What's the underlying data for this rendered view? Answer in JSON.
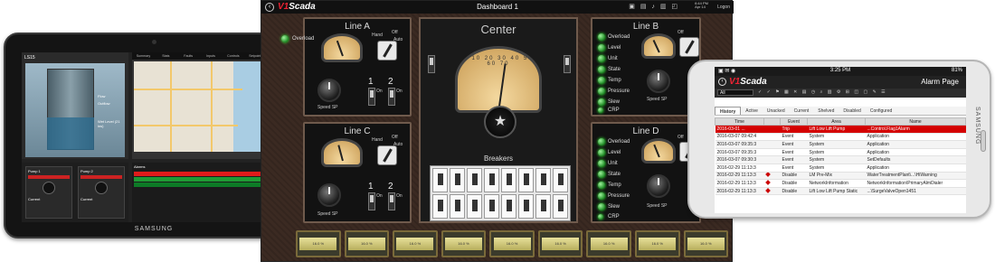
{
  "tablet": {
    "brand": "SAMSUNG",
    "screen_title": "LS15",
    "tabs": [
      "Summary",
      "Stats",
      "Faults",
      "Inputs",
      "Controls",
      "Setpoints",
      "Map"
    ],
    "active_tab": "Map",
    "well_labels": [
      "Flow",
      "Outflow",
      "Wet Level (21 ins)"
    ],
    "pumps": [
      {
        "label": "Pump 1",
        "current": "Current"
      },
      {
        "label": "Pump 2",
        "current": "Current"
      }
    ],
    "alarms_title": "Alarms",
    "alarm_colors": [
      "#e01b1b",
      "#1f9b35",
      "#0d7a26"
    ]
  },
  "dashboard": {
    "logo_a": "V1",
    "logo_b": "Scada",
    "title": "Dashboard 1",
    "time_line1": "6:44 PM",
    "time_line2": "Apr 14",
    "logon": "Logon",
    "lines": [
      {
        "name": "Line A",
        "lamps": [
          "Overload"
        ],
        "hand": "Hand",
        "off": "Off",
        "auto": "Auto",
        "speed": "Speed SP",
        "sw1": "1",
        "sw2": "2",
        "on": "On"
      },
      {
        "name": "Line B",
        "lamps": [
          "Overload",
          "Level",
          "Unit",
          "State",
          "Temp",
          "Pressure",
          "Slew",
          "CRP"
        ],
        "hand": "Hand",
        "off": "Off",
        "auto": "Auto",
        "speed": "Speed SP"
      },
      {
        "name": "Line C",
        "lamps": [],
        "hand": "Hand",
        "off": "Off",
        "auto": "Auto",
        "speed": "Speed SP",
        "sw1": "1",
        "sw2": "2",
        "on": "On"
      },
      {
        "name": "Line D",
        "lamps": [
          "Overload",
          "Level",
          "Unit",
          "State",
          "Temp",
          "Pressure",
          "Slew",
          "CRP"
        ],
        "hand": "Hand",
        "off": "Off",
        "auto": "Auto",
        "speed": "Speed SP"
      }
    ],
    "center_title": "Center",
    "vu_scale": [
      "0",
      "10",
      "20",
      "30",
      "40",
      "50",
      "60",
      "70"
    ],
    "breakers_label": "Breakers",
    "meters": [
      "16.0 %",
      "16.0 %",
      "16.0 %",
      "16.0 %",
      "16.0 %",
      "16.0 %",
      "16.0 %",
      "16.0 %",
      "16.0 %"
    ]
  },
  "phone": {
    "brand": "SAMSUNG",
    "time": "3:25 PM",
    "battery": "81%",
    "logo_a": "V1",
    "logo_b": "Scada",
    "page_title": "Alarm Page",
    "filter": "All",
    "tabs": [
      "History",
      "Active",
      "Unacked",
      "Current",
      "Shelved",
      "Disabled",
      "Configured"
    ],
    "active_tab": "History",
    "columns": [
      "Time",
      "",
      "Event",
      "Area",
      "Name"
    ],
    "rows": [
      {
        "time": "2016-03-01 ...",
        "icon": "",
        "event": "Trip",
        "area": "Lift Low Lift Pump",
        "name": "...Control.Flag1Alarm",
        "style": "red"
      },
      {
        "time": "2016-03-07 09:42:4",
        "icon": "",
        "event": "Event",
        "area": "System",
        "name": "Application",
        "style": ""
      },
      {
        "time": "2016-03-07 09:35:3",
        "icon": "",
        "event": "Event",
        "area": "System",
        "name": "Application",
        "style": "alt"
      },
      {
        "time": "2016-03-07 09:35:3",
        "icon": "",
        "event": "Event",
        "area": "System",
        "name": "Application",
        "style": ""
      },
      {
        "time": "2016-03-07 09:30:3",
        "icon": "",
        "event": "Event",
        "area": "System",
        "name": "SetDefaults",
        "style": "alt"
      },
      {
        "time": "2016-02-29 11:13:3",
        "icon": "",
        "event": "Event",
        "area": "System",
        "name": "Application",
        "style": ""
      },
      {
        "time": "2016-02-29 11:13:3",
        "icon": "diamond",
        "event": "Disable",
        "area": "LM Pre-Mix",
        "name": "WaterTreatmentPlant\\...\\HiWarning",
        "style": "alt"
      },
      {
        "time": "2016-02-29 11:13:3",
        "icon": "diamond",
        "event": "Disable",
        "area": "NetworkInformation",
        "name": "NetworkInformation\\PrimaryAlmDialer",
        "style": ""
      },
      {
        "time": "2016-02-29 11:13:3",
        "icon": "diamond",
        "event": "Disable",
        "area": "Lift Low Lift Pump Static",
        "name": "...\\SurgeValveOpen1451",
        "style": "alt"
      }
    ]
  }
}
